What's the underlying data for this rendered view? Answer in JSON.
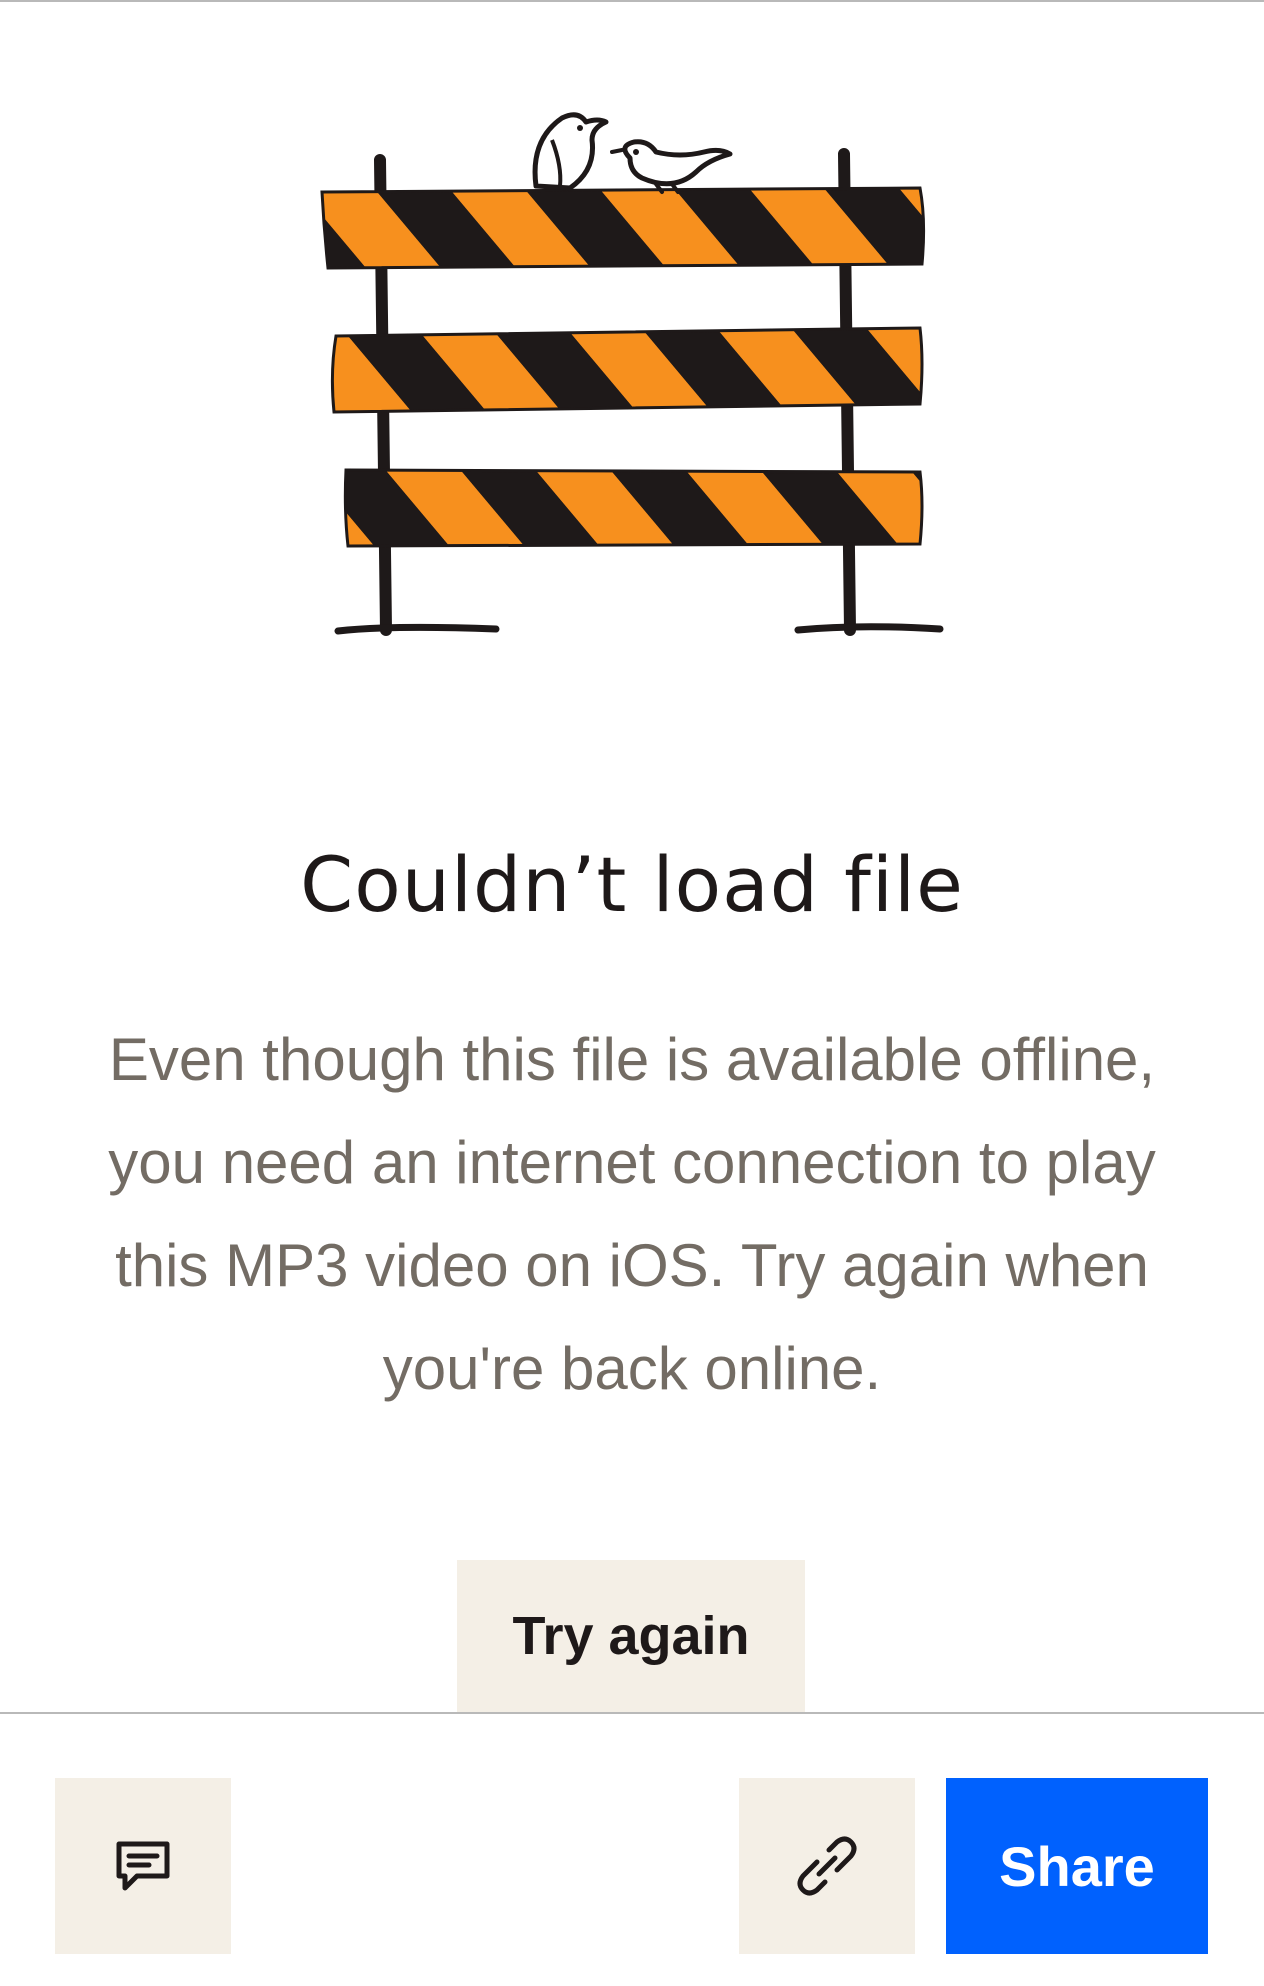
{
  "error": {
    "title": "Couldn’t load file",
    "message": "Even though this file is available offline, you need an internet connection to play this MP3 video on iOS. Try again when you're back online.",
    "retry_label": "Try again",
    "illustration": "road-barricade-with-birds"
  },
  "toolbar": {
    "comment_icon": "comment-icon",
    "link_icon": "link-icon",
    "share_label": "Share"
  },
  "colors": {
    "barricade_orange": "#f7901e",
    "barricade_black": "#1e1919",
    "share_blue": "#0061fe",
    "button_beige": "#f4efe6",
    "body_text": "#736c64"
  }
}
